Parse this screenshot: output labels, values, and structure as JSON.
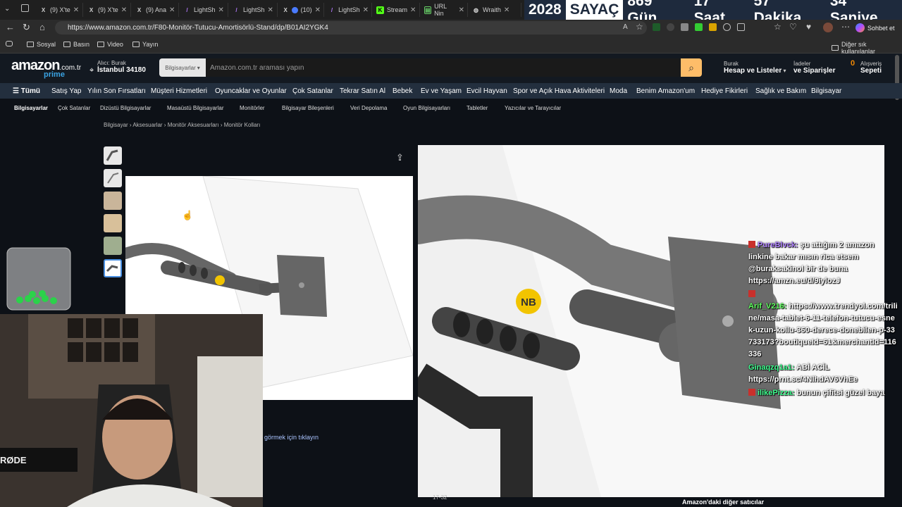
{
  "tabs": [
    {
      "icon": "x-icon",
      "label": "(9) X'te"
    },
    {
      "icon": "x-icon",
      "label": "(9) X'te"
    },
    {
      "icon": "x-icon",
      "label": "(9) Ana"
    },
    {
      "icon": "lightshot-icon",
      "label": "LightSh"
    },
    {
      "icon": "lightshot-icon",
      "label": "LightSh"
    },
    {
      "icon": "x-icon",
      "label": "(10)"
    },
    {
      "icon": "lightshot-icon",
      "label": "LightSh"
    },
    {
      "icon": "kick-icon",
      "label": "Stream"
    },
    {
      "icon": "url-icon",
      "label": "URL Nin"
    },
    {
      "icon": "globe-icon",
      "label": "Wraith"
    }
  ],
  "counter": {
    "year": "2028",
    "label": "SAYAÇ",
    "days": "869 Gün",
    "hours": "17 Saat",
    "minutes": "57 Dakika",
    "seconds": "34 Saniye"
  },
  "browser": {
    "url": "https://www.amazon.com.tr/F80-Monitör-Tutucu-Amortisörlü-Stand/dp/B01AI2YGK4",
    "chat_button": "Sohbet et",
    "favorites": [
      "Sosyal",
      "Basın",
      "Video",
      "Yayın"
    ],
    "other_favorites": "Diğer sık kullanılanlar"
  },
  "amazon": {
    "logo": "amazon",
    "logo_domain": ".com.tr",
    "prime": "prime",
    "deliver_to": "Alıcı: Burak",
    "deliver_city": "İstanbul 34180",
    "category": "Bilgisayarlar",
    "search_placeholder": "Amazon.com.tr araması yapın",
    "account_small": "Burak",
    "account_big": "Hesap ve Listeler",
    "returns_small": "İadeler",
    "returns_big": "ve Siparişler",
    "cart_count": "0",
    "cart_small": "Alışveriş",
    "cart_big": "Sepeti"
  },
  "nav1": [
    "Tümü",
    "Satış Yap",
    "Yılın Son Fırsatları",
    "Müşteri Hizmetleri",
    "Oyuncaklar ve Oyunlar",
    "Çok Satanlar",
    "Tekrar Satın Al",
    "Bebek",
    "Ev ve Yaşam",
    "Evcil Hayvan",
    "Spor ve Açık Hava Aktiviteleri",
    "Moda",
    "Benim Amazon'um",
    "Hediye Fikirleri",
    "Sağlık ve Bakım",
    "Bilgisayar"
  ],
  "nav2": [
    "Bilgisayarlar",
    "Çok Satanlar",
    "Dizüstü Bilgisayarlar",
    "Masaüstü Bilgisayarlar",
    "Monitörler",
    "Bilgisayar Bileşenleri",
    "Veri Depolama",
    "Oyun Bilgisayarları",
    "Tabletler",
    "Yazıcılar ve Tarayıcılar"
  ],
  "breadcrumb": "Bilgisayar › Aksesuarlar › Monitör Aksesuarları › Monitör Kolları",
  "product": {
    "click_hint": "görmek için tıklayın",
    "page_number": "17-32",
    "brand_badge": "NB"
  },
  "bottom_text": "Amazon'daki diğer satıcılar",
  "chat": [
    {
      "user": "PureBlvck:",
      "text": " şu attığım 2 amazon linkine bakar mısın rica etsem @buraksakinol bir de buna https://amzn.eu/d/9iylozJ"
    },
    {
      "user": "Arif_V216:",
      "text": " https://www.trendyol.com/triline/masa-tablet-6-11-telefon-tutucu-esnek-uzun-kollu-360-derece-donebilen-p-33733173?boutiqueId=61&merchantId=116336"
    },
    {
      "user": "Ginaqzq1a1:",
      "text": " ABİ ACİL https://prnt.sc/4NlhdAV6VhEe"
    },
    {
      "user": "ilikePizza:",
      "text": " bunun çifitsi güzel baya"
    }
  ],
  "webcam": {
    "mic_label": "RØDE"
  }
}
